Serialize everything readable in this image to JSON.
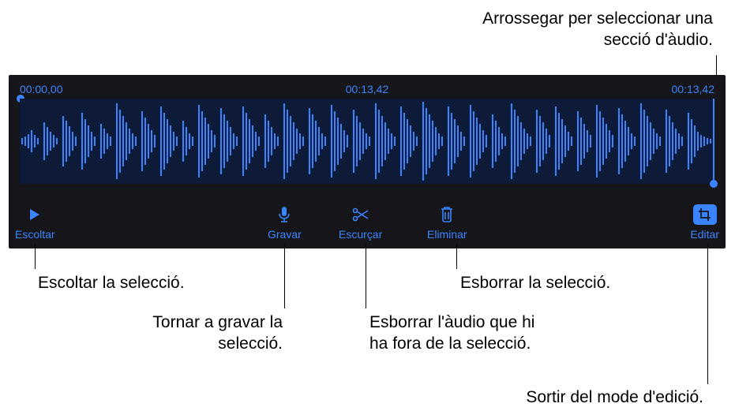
{
  "top_callout": {
    "line1": "Arrossegar per seleccionar una",
    "line2": "secció d'àudio."
  },
  "editor": {
    "time_start": "00:00,00",
    "time_current": "00:13,42",
    "time_end": "00:13,42"
  },
  "toolbar": {
    "listen": "Escoltar",
    "record": "Gravar",
    "trim": "Escurçar",
    "delete": "Eliminar",
    "edit": "Editar"
  },
  "callouts": {
    "listen": "Escoltar la selecció.",
    "record_l1": "Tornar a gravar la",
    "record_l2": "selecció.",
    "trim_l1": "Esborrar l'àudio que hi",
    "trim_l2": "ha fora de la selecció.",
    "delete": "Esborrar la selecció.",
    "edit": "Sortir del mode d'edició."
  }
}
